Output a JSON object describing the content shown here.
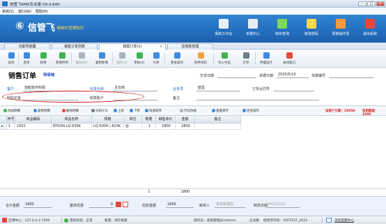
{
  "window": {
    "title": "信管飞RMS专业版 V9.4.640"
  },
  "menu": [
    "系统(S)",
    "窗口(W)",
    "帮助(H)"
  ],
  "brand": {
    "logo_mark": "⑥",
    "logo_text": "信管飞",
    "slogan": "·精细化管理软件"
  },
  "top_buttons": [
    {
      "label": "我的工作台",
      "color": "#e9eff7"
    },
    {
      "label": "单据中心",
      "color": "#e9eff7"
    },
    {
      "label": "库存查询",
      "color": "#7ed957"
    },
    {
      "label": "修改密码",
      "color": "#ffd84a"
    },
    {
      "label": "更换操作员",
      "color": "#ff9a3c"
    },
    {
      "label": "退出系统",
      "color": "#e8463c"
    }
  ],
  "tabs": [
    {
      "label": "功能导航器"
    },
    {
      "label": "销售订单列表"
    },
    {
      "label": "销售订单(1)"
    },
    {
      "label": "应收款管理"
    }
  ],
  "toolbar": [
    {
      "label": "前单",
      "color": "#3d8be0",
      "disabled": false
    },
    {
      "label": "后单",
      "color": "#3d8be0",
      "disabled": false
    },
    {
      "label": "新增",
      "color": "#3fb34f",
      "disabled": false
    },
    {
      "label": "新增开单",
      "color": "#3fb34f",
      "disabled": false
    },
    {
      "label": "删除(D)",
      "color": "#a8b4c2",
      "disabled": true
    },
    {
      "label": "复制新增",
      "color": "#3d8be0",
      "disabled": false
    },
    {
      "label": "保存(S)",
      "color": "#a8b4c2",
      "disabled": true
    },
    {
      "label": "审核(A)",
      "color": "#3fb34f",
      "disabled": false
    },
    {
      "label": "引单",
      "color": "#3d8be0",
      "disabled": false
    },
    {
      "label": "更多操作",
      "color": "#3d8be0",
      "disabled": false
    },
    {
      "label": "附件资料",
      "color": "#f2a43a",
      "disabled": false
    },
    {
      "label": "导入导出",
      "color": "#3fb34f",
      "disabled": false
    },
    {
      "label": "打印",
      "color": "#6c7b8b",
      "disabled": false
    },
    {
      "label": "界面设计",
      "color": "#3d8be0",
      "disabled": false
    },
    {
      "label": "关闭窗口",
      "color": "#e8463c",
      "disabled": false
    }
  ],
  "form": {
    "title": "销售订单",
    "status": "待审核",
    "doc_no_label": "交货日期",
    "date_label": "单据日期",
    "date_value": "2025/5/10",
    "bill_no_label": "单据编号",
    "customer_label": "客户",
    "customer_value": "亚航软件科技",
    "warehouse_label": "出货仓库",
    "warehouse_value": "主仓库",
    "salesman_label": "业务员",
    "salesman_value": "欧显",
    "order_no_label": "订单合同号",
    "deposit_label": "收取定金",
    "account_label": "收款账户",
    "remark_label": "备注"
  },
  "subtoolbar": [
    {
      "label": "添加明细",
      "color": "#3fb34f"
    },
    {
      "label": "复制明细",
      "color": "#3d8be0"
    },
    {
      "label": "删除明细",
      "color": "#e8463c"
    },
    {
      "label": "扫码(F4)",
      "color": "#6c7b8b"
    },
    {
      "label": "上移",
      "color": "#3d8be0"
    },
    {
      "label": "下移",
      "color": "#3d8be0"
    },
    {
      "label": "快速排序",
      "color": "#3d8be0"
    },
    {
      "label": "尺码风格",
      "color": "#a8b4c2"
    },
    {
      "label": "重置库存",
      "color": "#3d8be0"
    },
    {
      "label": "更多操作",
      "color": "#3d8be0"
    }
  ],
  "balance": {
    "receivable_label": "该客户欠款：",
    "receivable_value": "20058",
    "credit_label": "信用额度：",
    "credit_value": "1000"
  },
  "grid": {
    "columns": [
      "序号",
      "商品编码",
      "商品名称",
      "规格",
      "单位",
      "数量",
      "销售单价",
      "金额",
      "备注"
    ],
    "rows": [
      {
        "index": "1",
        "code": "1001",
        "name": "EPSON LQ-630K",
        "spec": "LQ-630K | 620K",
        "unit": "台",
        "qty": "1",
        "price": "1800",
        "amount": "1800",
        "remark": ""
      }
    ],
    "footer_qty": "1",
    "footer_amount": "1800"
  },
  "footer": {
    "total_label": "合计金额",
    "total_value": "1800",
    "discount_label": "整单优惠",
    "discount_value": "0",
    "payable_label": "应收金额",
    "payable_value": "1800",
    "maker_label": "制单人",
    "maker_value": "系统管理员",
    "make_date_label": "制单日期",
    "make_date_value": "2025/5/10"
  },
  "statusbar": {
    "app_center": "应用中心：127.0.0.1:7099",
    "connection": "连接状态：正常",
    "account": "账套：演示账套",
    "operator": "操作员：系统管理员(admin)",
    "edition": "正式版",
    "serial": "授权序列号：SOFTEST_2022",
    "message_center": "消息提醒中心"
  }
}
